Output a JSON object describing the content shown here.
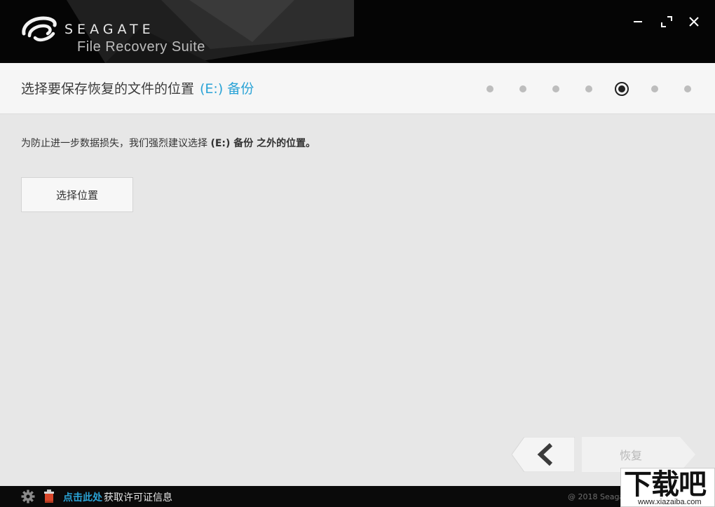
{
  "header": {
    "brand": "SEAGATE",
    "product": "File Recovery Suite"
  },
  "window_controls": {
    "minimize_icon": "minimize-icon",
    "maximize_icon": "maximize-icon",
    "close_icon": "close-icon"
  },
  "stepbar": {
    "title": "选择要保存恢复的文件的位置",
    "drive": "(E:) 备份",
    "steps_total": 7,
    "current_step": 5
  },
  "main": {
    "notice_prefix": "为防止进一步数据损失，我们强烈建议选择 ",
    "notice_bold": "(E:) 备份 之外的位置。",
    "choose_button": "选择位置"
  },
  "nav": {
    "back_icon": "chevron-left-icon",
    "recover_button": "恢复"
  },
  "footer": {
    "license_link": "点击此处",
    "license_text": "获取许可证信息",
    "copyright": "@ 2018 Seaga"
  },
  "watermark": {
    "main": "下载吧",
    "sub": "www.xiazaiba.com"
  },
  "colors": {
    "accent": "#2aa3d6",
    "header_bg": "#050505",
    "content_bg": "#e7e7e7",
    "stepbar_bg": "#f6f6f6"
  }
}
